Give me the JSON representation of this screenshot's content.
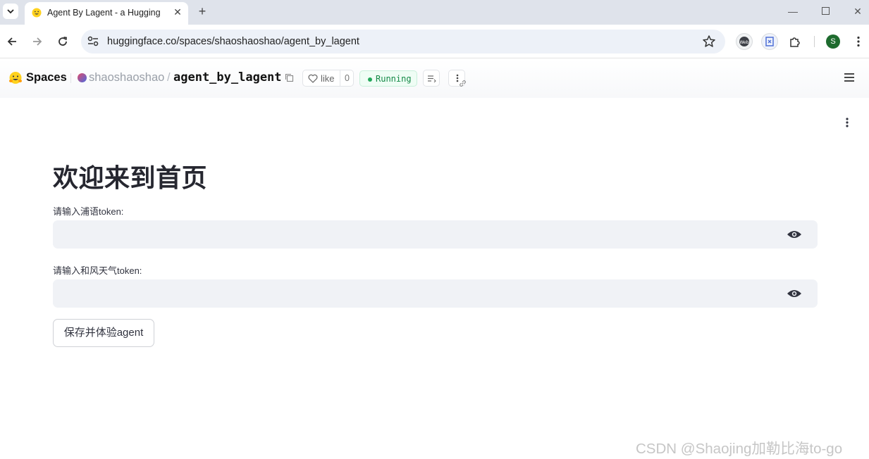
{
  "browser": {
    "tab_title": "Agent By Lagent - a Hugging",
    "new_tab_symbol": "+",
    "url": "huggingface.co/spaces/shaoshaoshao/agent_by_lagent",
    "profile_initial": "S"
  },
  "space_header": {
    "section": "Spaces",
    "owner": "shaoshaoshao",
    "separator": "/",
    "repo": "agent_by_lagent",
    "like_label": "like",
    "like_count": "0",
    "status": "Running"
  },
  "app": {
    "title": "欢迎来到首页",
    "field1_label": "请输入浦语token:",
    "field1_value": "",
    "field2_label": "请输入和风天气token:",
    "field2_value": "",
    "save_button": "保存并体验agent"
  },
  "watermark": "CSDN @Shaojing加勒比海to-go",
  "colors": {
    "tabstrip": "#dfe3eb",
    "omnibox": "#edf1f8",
    "field_bg": "#f0f2f6",
    "running_green": "#22a85a",
    "profile_green": "#1e6b2e"
  }
}
